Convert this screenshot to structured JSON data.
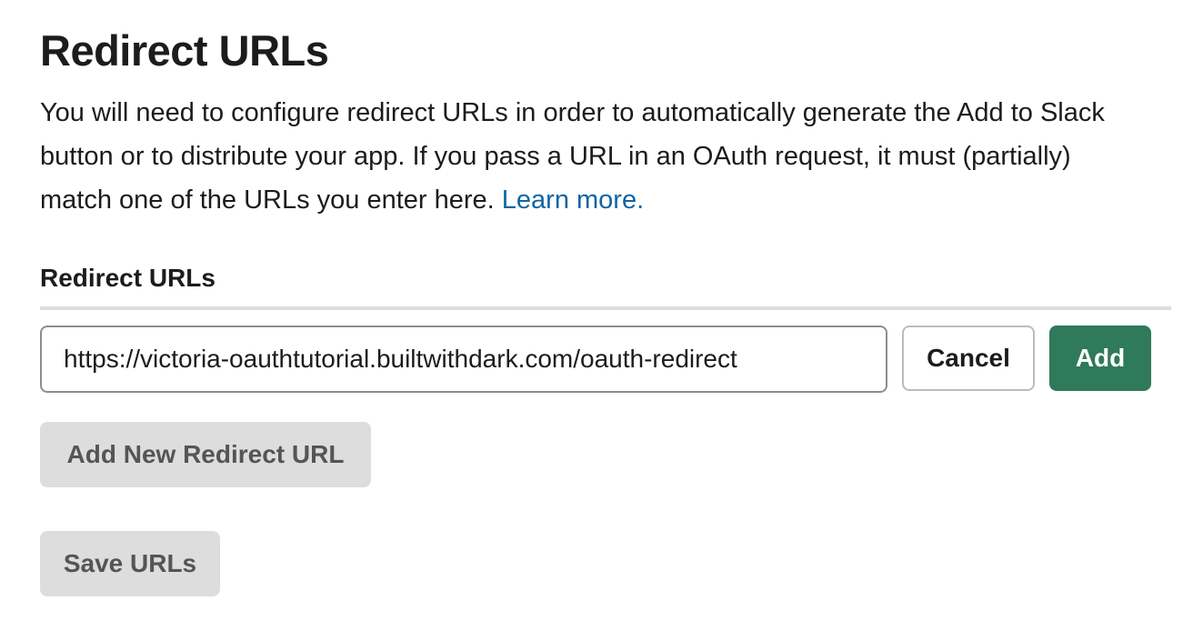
{
  "page": {
    "title": "Redirect URLs",
    "description": "You will need to configure redirect URLs in order to automatically generate the Add to Slack button or to distribute your app. If you pass a URL in an OAuth request, it must (partially) match one of the URLs you enter here.",
    "learn_more_label": "Learn more."
  },
  "redirect_urls": {
    "label": "Redirect URLs",
    "input_value": "https://victoria-oauthtutorial.builtwithdark.com/oauth-redirect",
    "cancel_label": "Cancel",
    "add_label": "Add",
    "add_new_label": "Add New Redirect URL",
    "save_label": "Save URLs"
  },
  "colors": {
    "link": "#1264a3",
    "primary_button": "#2f7a5b",
    "secondary_button": "#dddddd",
    "secondary_button_text": "#555555",
    "divider": "#dddddd"
  }
}
